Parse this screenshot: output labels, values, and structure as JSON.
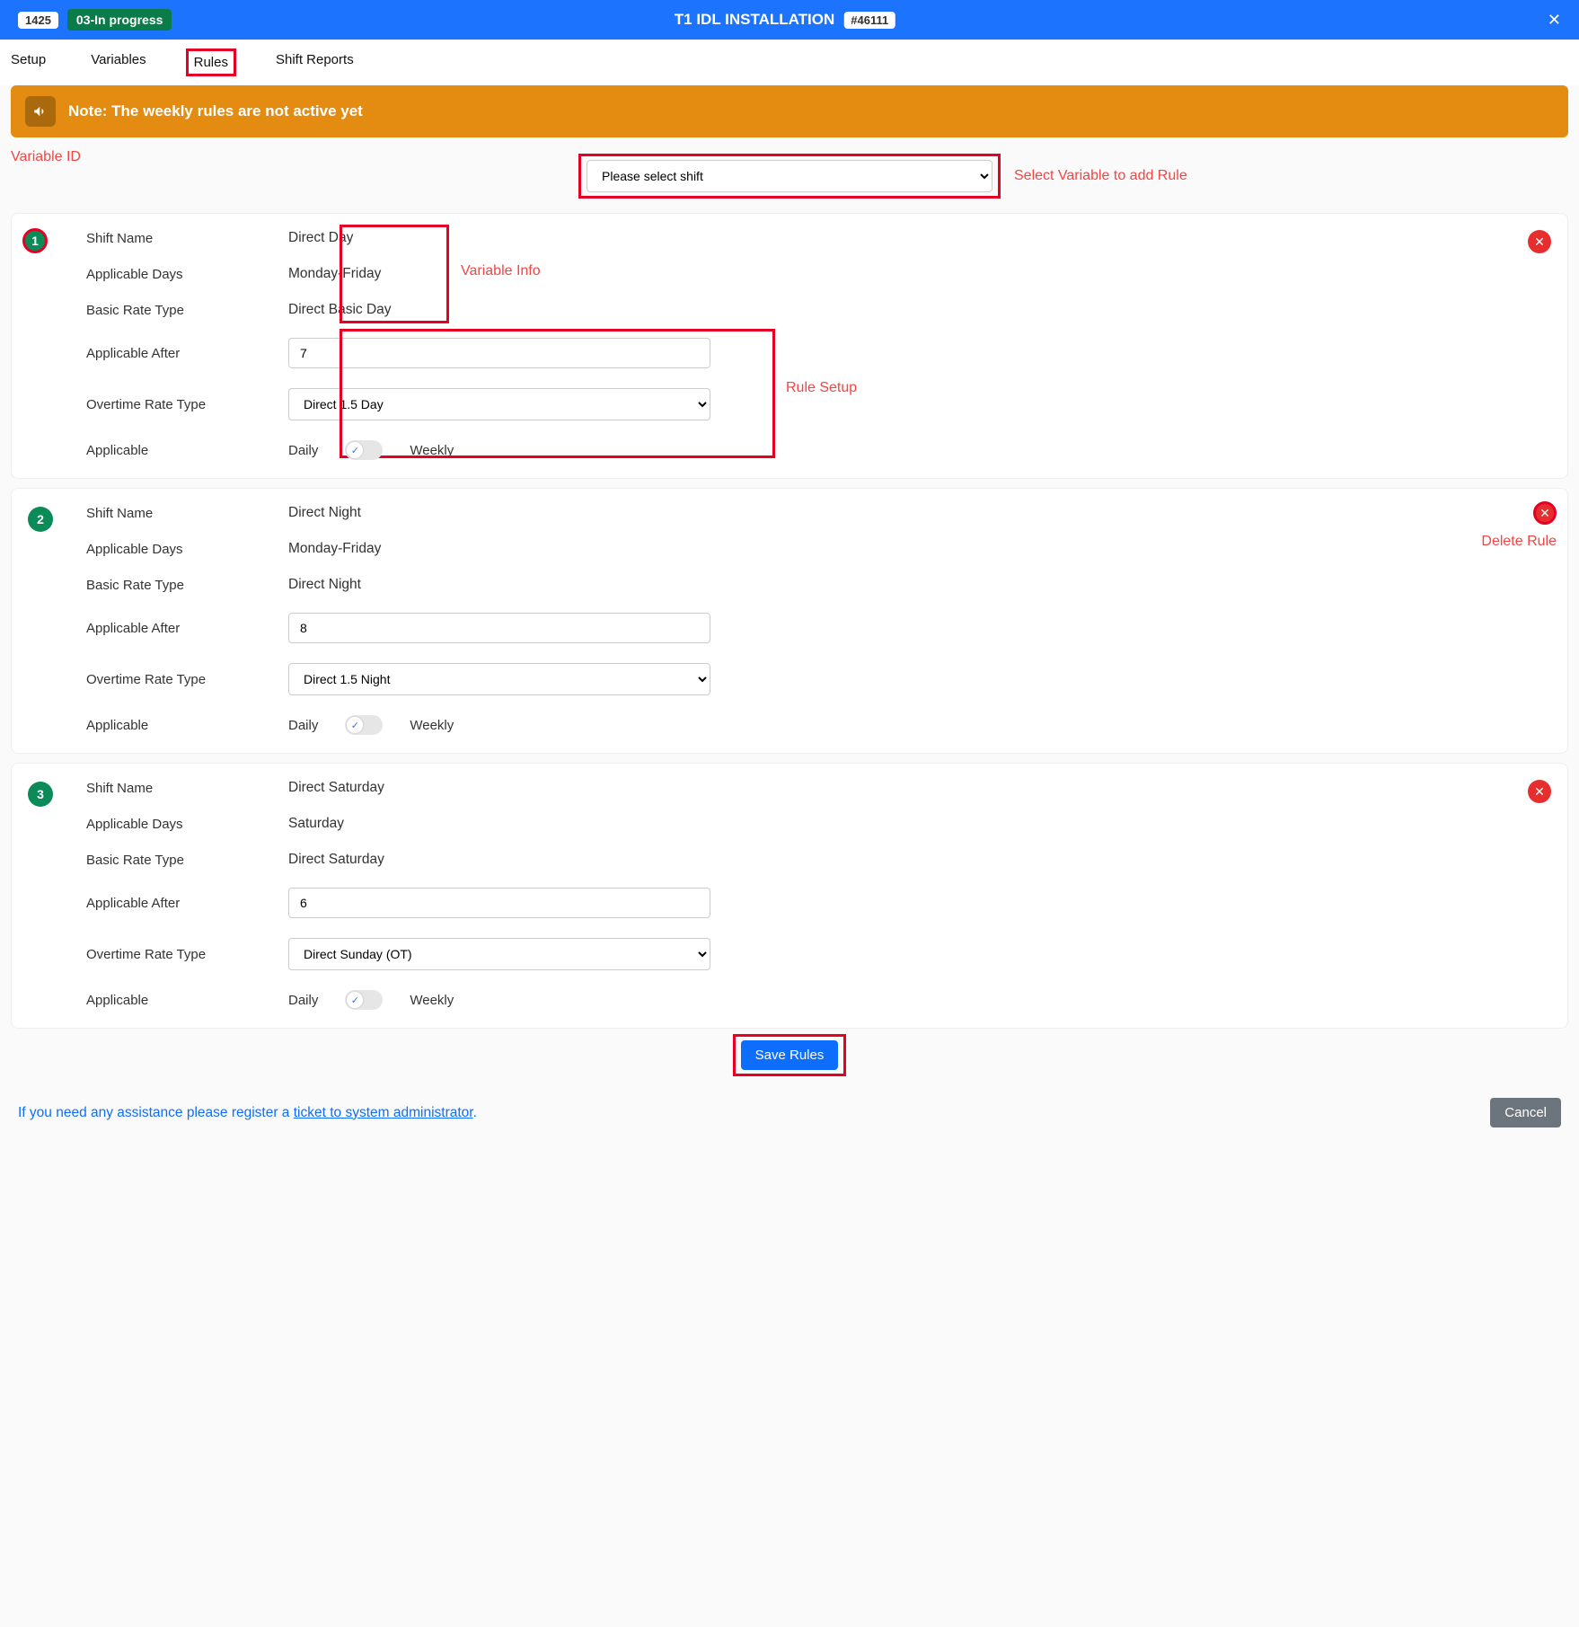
{
  "header": {
    "project_number": "1425",
    "status": "03-In progress",
    "title": "T1 IDL INSTALLATION",
    "ref": "#46111"
  },
  "tabs": {
    "setup": "Setup",
    "variables": "Variables",
    "rules": "Rules",
    "shift_reports": "Shift Reports"
  },
  "note": {
    "text": "Note: The weekly rules are not active yet"
  },
  "shift_select": {
    "placeholder": "Please select shift"
  },
  "annotations": {
    "variable_id": "Variable ID",
    "select_var": "Select Variable to add Rule",
    "variable_info": "Variable Info",
    "rule_setup": "Rule Setup",
    "delete_rule": "Delete Rule"
  },
  "labels": {
    "shift_name": "Shift Name",
    "applicable_days": "Applicable Days",
    "basic_rate_type": "Basic Rate Type",
    "applicable_after": "Applicable After",
    "overtime_rate_type": "Overtime Rate Type",
    "applicable": "Applicable",
    "daily": "Daily",
    "weekly": "Weekly"
  },
  "rules": [
    {
      "id": "1",
      "shift_name": "Direct Day",
      "applicable_days": "Monday-Friday",
      "basic_rate_type": "Direct Basic Day",
      "applicable_after": "7",
      "overtime_rate_type": "Direct 1.5 Day"
    },
    {
      "id": "2",
      "shift_name": "Direct Night",
      "applicable_days": "Monday-Friday",
      "basic_rate_type": "Direct Night",
      "applicable_after": "8",
      "overtime_rate_type": "Direct 1.5 Night"
    },
    {
      "id": "3",
      "shift_name": "Direct Saturday",
      "applicable_days": "Saturday",
      "basic_rate_type": "Direct Saturday",
      "applicable_after": "6",
      "overtime_rate_type": "Direct Sunday (OT)"
    }
  ],
  "buttons": {
    "save": "Save Rules",
    "cancel": "Cancel"
  },
  "footer": {
    "pretext": "If you need any assistance please register a ",
    "link": "ticket to system administrator",
    "post": "."
  }
}
